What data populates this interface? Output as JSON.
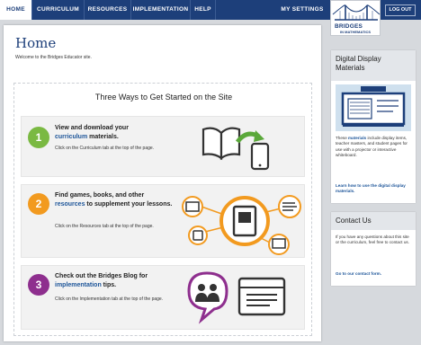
{
  "nav": {
    "items": [
      "HOME",
      "CURRICULUM",
      "RESOURCES",
      "IMPLEMENTATION",
      "HELP"
    ],
    "my_settings": "MY SETTINGS",
    "logout": "LOG OUT"
  },
  "brand": {
    "line1": "BRIDGES",
    "line2": "IN MATHEMATICS"
  },
  "main": {
    "title": "Home",
    "welcome": "Welcome to the Bridges Educator site.",
    "section_title": "Three Ways to Get Started on the Site",
    "steps": [
      {
        "number": "1",
        "head_a": "View and download your",
        "head_link": "curriculum",
        "head_b": " materials.",
        "sub": "Click on the Curriculum tab at the top of the page.",
        "color": "#7ab942"
      },
      {
        "number": "2",
        "head_a": "Find games, books, and other",
        "head_link": "resources",
        "head_b": " to supplement your lessons.",
        "sub": "Click on the Resources tab at the top of the page.",
        "color": "#f29a1f"
      },
      {
        "number": "3",
        "head_a": "Check out the Bridges Blog for",
        "head_link": "implementation",
        "head_b": " tips.",
        "sub": "Click on the Implementation tab at the top of the page.",
        "color": "#8e2f8e"
      }
    ]
  },
  "sidebar": {
    "display": {
      "title": "Digital Display Materials",
      "text_a": "These ",
      "text_link": "materials",
      "text_b": " include display items, teacher masters, and student pages for use with a projector or interactive whiteboard.",
      "link": "Learn how to use the digital display materials."
    },
    "contact": {
      "title": "Contact Us",
      "text": "If you have any questions about this site or the curriculum, feel free to contact us.",
      "link": "Go to our contact form."
    }
  }
}
